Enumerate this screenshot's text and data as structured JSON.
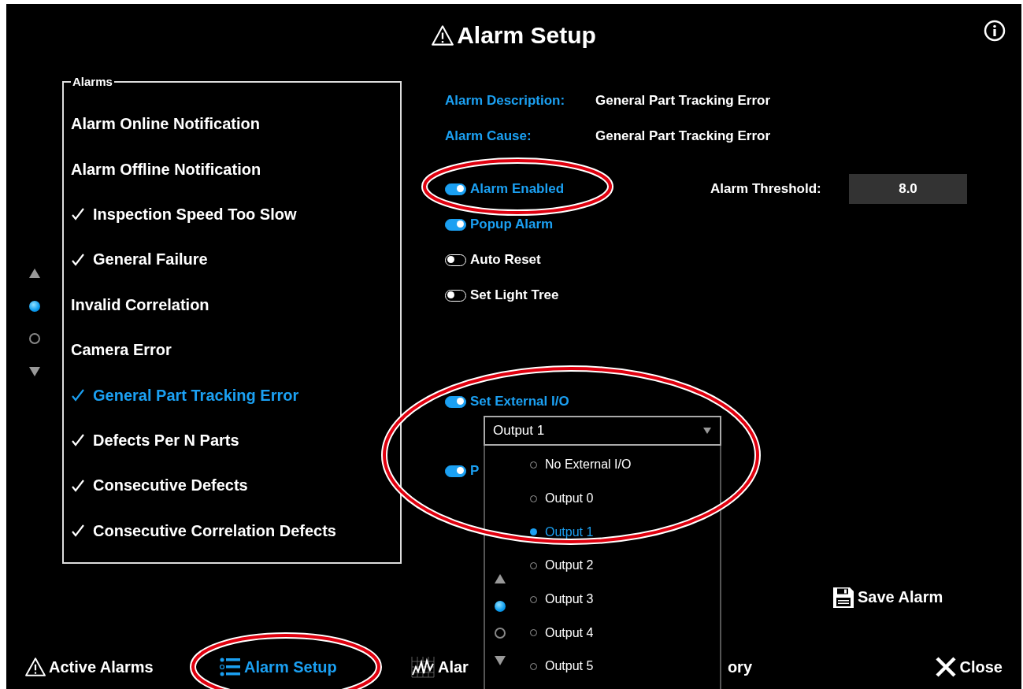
{
  "title": "Alarm Setup",
  "alarms": {
    "legend": "Alarms",
    "items": [
      {
        "label": "Alarm Online Notification",
        "checked": false,
        "selected": false
      },
      {
        "label": "Alarm Offline Notification",
        "checked": false,
        "selected": false
      },
      {
        "label": "Inspection Speed Too Slow",
        "checked": true,
        "selected": false
      },
      {
        "label": "General Failure",
        "checked": true,
        "selected": false
      },
      {
        "label": "Invalid Correlation",
        "checked": false,
        "selected": false
      },
      {
        "label": "Camera Error",
        "checked": false,
        "selected": false
      },
      {
        "label": "General Part Tracking Error",
        "checked": true,
        "selected": true
      },
      {
        "label": "Defects Per N Parts",
        "checked": true,
        "selected": false
      },
      {
        "label": "Consecutive Defects",
        "checked": true,
        "selected": false
      },
      {
        "label": "Consecutive Correlation Defects",
        "checked": true,
        "selected": false
      }
    ],
    "pages": [
      {
        "selected": true
      },
      {
        "selected": false
      }
    ]
  },
  "details": {
    "description_label": "Alarm Description:",
    "description": "General Part Tracking Error",
    "cause_label": "Alarm Cause:",
    "cause": "General Part Tracking Error"
  },
  "threshold": {
    "label": "Alarm Threshold:",
    "value": "8.0"
  },
  "toggles": [
    {
      "label": "Alarm Enabled",
      "on": true
    },
    {
      "label": "Popup Alarm",
      "on": true
    },
    {
      "label": "Auto Reset",
      "on": false
    },
    {
      "label": "Set Light Tree",
      "on": false
    },
    {
      "label": "Set External I/O",
      "on": true
    },
    {
      "label": "P",
      "on": true
    }
  ],
  "external_io": {
    "value": "Output 1",
    "expanded": true,
    "options": [
      {
        "label": "No External I/O",
        "selected": false
      },
      {
        "label": "Output 0",
        "selected": false
      },
      {
        "label": "Output 1",
        "selected": true
      },
      {
        "label": "Output 2",
        "selected": false
      },
      {
        "label": "Output 3",
        "selected": false
      },
      {
        "label": "Output 4",
        "selected": false
      },
      {
        "label": "Output 5",
        "selected": false
      }
    ],
    "pages": [
      {
        "selected": true
      },
      {
        "selected": false
      }
    ]
  },
  "save_button": "Save Alarm",
  "nav": [
    {
      "label": "Active Alarms",
      "kind": "warning",
      "selected": false
    },
    {
      "label": "Alarm Setup",
      "kind": "list",
      "selected": true
    },
    {
      "label": "Alar",
      "label_end": "ory",
      "kind": "chart",
      "selected": false
    }
  ],
  "close_button": "Close"
}
